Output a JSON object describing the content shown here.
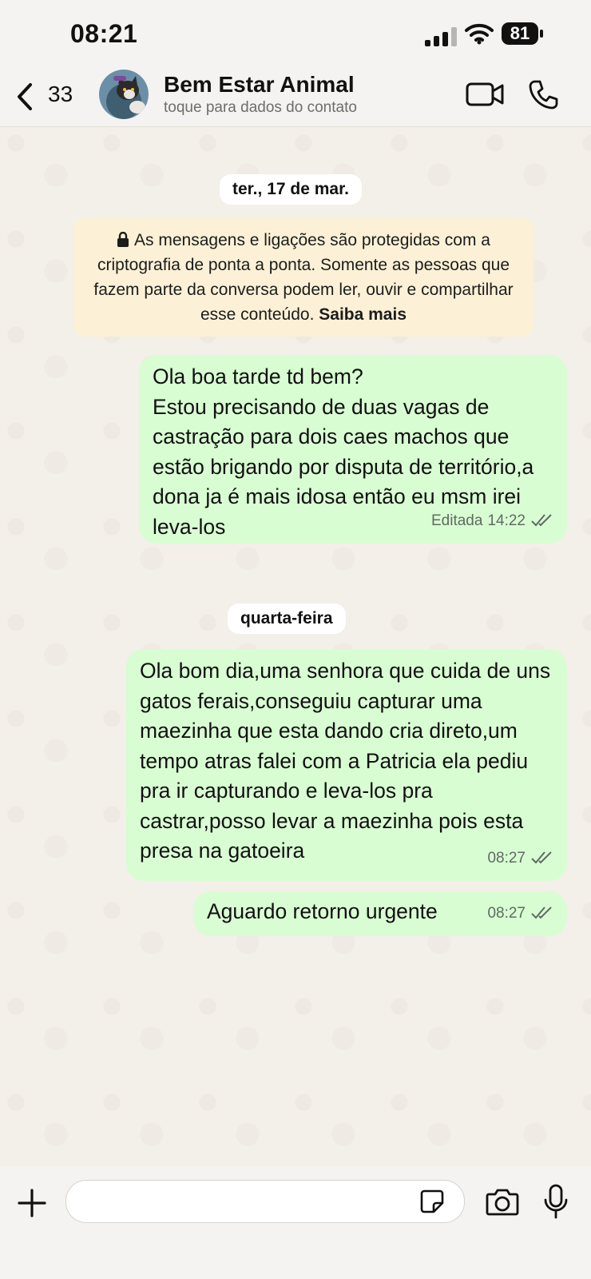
{
  "status_bar": {
    "time": "08:21",
    "battery": "81"
  },
  "header": {
    "back_count": "33",
    "contact_name": "Bem Estar Animal",
    "contact_subtitle": "toque para dados do contato"
  },
  "chat": {
    "date_1": "ter., 17 de mar.",
    "encryption_notice": "As mensagens e ligações são protegidas com a criptografia de ponta a ponta. Somente as pessoas que fazem parte da conversa podem ler, ouvir e compartilhar esse conteúdo.",
    "encryption_link": "Saiba mais",
    "date_2": "quarta-feira",
    "messages": [
      {
        "text": "Ola boa tarde td bem?\nEstou precisando de duas vagas de castração para dois caes machos que estão brigando por disputa de território,a dona ja é mais idosa então eu msm irei leva-los",
        "edited": "Editada",
        "time": "14:22"
      },
      {
        "text": "Ola bom dia,uma senhora que cuida de uns gatos ferais,conseguiu capturar uma maezinha que esta dando cria direto,um tempo atras falei com a Patricia ela pediu pra ir capturando e leva-los pra castrar,posso levar a maezinha pois esta presa na gatoeira",
        "time": "08:27"
      },
      {
        "text": "Aguardo retorno urgente",
        "time": "08:27"
      }
    ]
  },
  "input": {
    "placeholder": ""
  },
  "icons": {
    "back": "chevron-left-icon",
    "video": "video-call-icon",
    "phone": "phone-icon",
    "plus": "plus-icon",
    "sticker": "sticker-icon",
    "camera": "camera-icon",
    "mic": "microphone-icon",
    "ticks": "double-check-icon"
  },
  "colors": {
    "outgoing_bubble": "#d9fdd3",
    "notice_bg": "#fcf1d6",
    "chat_bg": "#f3efe9",
    "tick_color": "#5e6b61"
  }
}
